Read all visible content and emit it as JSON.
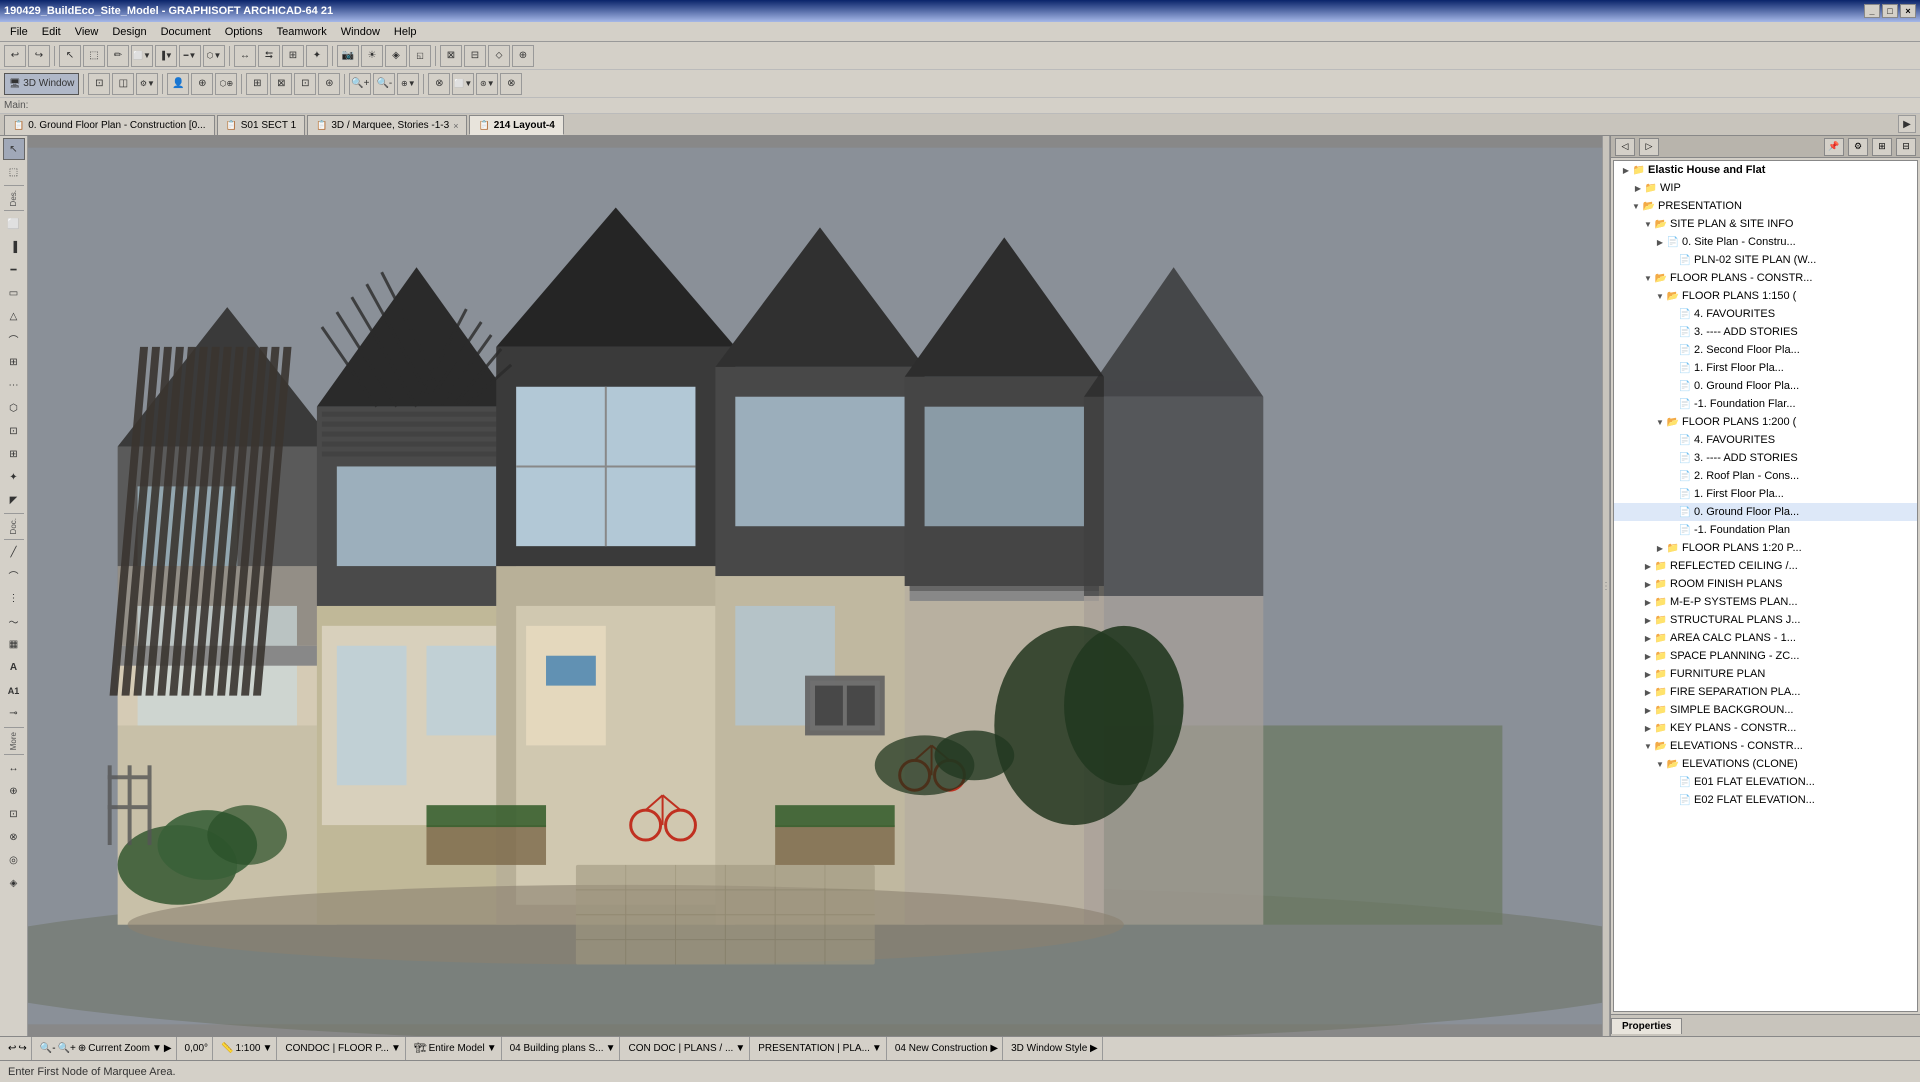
{
  "app": {
    "title": "190429_BuildEco_Site_Model - GRAPHISOFT ARCHICAD-64 21",
    "window_controls": [
      "_",
      "□",
      "×"
    ]
  },
  "menu": {
    "items": [
      "File",
      "Edit",
      "View",
      "Design",
      "Document",
      "Options",
      "Teamwork",
      "Window",
      "Help"
    ]
  },
  "toolbar1": {
    "buttons": [
      "↩",
      "↪",
      "⊕",
      "⊘",
      "🖊",
      "✏",
      "📐",
      "📏",
      "⚙",
      "▼",
      "◈",
      "▼",
      "⬡",
      "▼",
      "⬜",
      "▼",
      "↔",
      "◎",
      "↗",
      "▶",
      "◼",
      "⬟",
      "⊞",
      "✦",
      "📷",
      "🔧",
      "✂",
      "⊡",
      "⊠",
      "⬦",
      "◎",
      "🔲",
      "⊕",
      "▼"
    ]
  },
  "toolbar2": {
    "mode_label": "3D Window",
    "buttons": [
      "⊡",
      "◫",
      "⚙",
      "▼",
      "👤",
      "⊕",
      "⊗",
      "⬡",
      "⊕",
      "⊗",
      "⊞",
      "⊠",
      "⊡",
      "⊛",
      "▶",
      "▼",
      "⊕",
      "◈",
      "⊗",
      "▼",
      "⊗",
      "⊕",
      "⊖",
      "🔲",
      "◫",
      "⊕",
      "⊗",
      "⊡",
      "📷",
      "▼",
      "⊕",
      "⬜",
      "▼",
      "⊛",
      "⊗"
    ]
  },
  "tabs": [
    {
      "id": "tab1",
      "icon": "📋",
      "label": "0. Ground Floor Plan - Construction [0...",
      "active": false,
      "closable": false
    },
    {
      "id": "tab2",
      "icon": "📋",
      "label": "S01 SECT 1",
      "active": false,
      "closable": false
    },
    {
      "id": "tab3",
      "icon": "📋",
      "label": "3D / Marquee, Stories -1-3",
      "active": false,
      "closable": true
    },
    {
      "id": "tab4",
      "icon": "📋",
      "label": "214 Layout-4",
      "active": true,
      "closable": false
    }
  ],
  "left_toolbar": {
    "sections": [
      {
        "label": "Des.",
        "buttons": [
          "↖",
          "⬚",
          "⬜",
          "△",
          "⬡",
          "⬢",
          "◎",
          "⬟",
          "⌒",
          "⋯",
          "✒",
          "⊡",
          "⊠",
          "✦",
          "◤",
          "⊕"
        ]
      },
      {
        "label": "Doc.",
        "buttons": [
          "📝",
          "⊞",
          "⊗",
          "⬡",
          "⊕",
          "A",
          "A1",
          "⋯"
        ]
      },
      {
        "label": "More",
        "buttons": [
          "↔",
          "⊕",
          "⊡",
          "⊗",
          "⬜",
          "◎"
        ]
      }
    ]
  },
  "viewport": {
    "background_color": "#7a8090"
  },
  "right_panel": {
    "header_buttons": [
      "◁",
      "▷",
      "⊡",
      "⊞",
      "⊕",
      "⊗"
    ],
    "tree": {
      "items": [
        {
          "id": "elastic-house",
          "level": 0,
          "toggle": "▶",
          "icon": "📁",
          "label": "Elastic House and Flat",
          "bold": true
        },
        {
          "id": "wip",
          "level": 1,
          "toggle": "▶",
          "icon": "📁",
          "label": "WIP"
        },
        {
          "id": "presentation",
          "level": 1,
          "toggle": "▼",
          "icon": "📂",
          "label": "PRESENTATION"
        },
        {
          "id": "site-plan-info",
          "level": 2,
          "toggle": "▼",
          "icon": "📂",
          "label": "SITE PLAN & SITE INFO"
        },
        {
          "id": "site-plan-constr",
          "level": 3,
          "toggle": "▶",
          "icon": "📄",
          "label": "0. Site Plan - Constru..."
        },
        {
          "id": "pln-02",
          "level": 3,
          "toggle": "",
          "icon": "📄",
          "label": "PLN-02 SITE PLAN (W..."
        },
        {
          "id": "floor-plans-constr",
          "level": 2,
          "toggle": "▼",
          "icon": "📂",
          "label": "FLOOR PLANS - CONSTR..."
        },
        {
          "id": "floor-plans-1150",
          "level": 3,
          "toggle": "▼",
          "icon": "📂",
          "label": "FLOOR PLANS 1:150 ("
        },
        {
          "id": "favourites-1",
          "level": 4,
          "toggle": "",
          "icon": "📄",
          "label": "4. FAVOURITES"
        },
        {
          "id": "add-stories-1",
          "level": 4,
          "toggle": "",
          "icon": "📄",
          "label": "3. ---- ADD STORIES"
        },
        {
          "id": "second-floor-1",
          "level": 4,
          "toggle": "",
          "icon": "📄",
          "label": "2. Second Floor Pla..."
        },
        {
          "id": "first-floor-1",
          "level": 4,
          "toggle": "",
          "icon": "📄",
          "label": "1. First Floor Pla..."
        },
        {
          "id": "ground-floor-1",
          "level": 4,
          "toggle": "",
          "icon": "📄",
          "label": "0. Ground Floor Pla..."
        },
        {
          "id": "foundation-1",
          "level": 4,
          "toggle": "",
          "icon": "📄",
          "label": "-1. Foundation Flar..."
        },
        {
          "id": "floor-plans-1200",
          "level": 3,
          "toggle": "▼",
          "icon": "📂",
          "label": "FLOOR PLANS 1:200 ("
        },
        {
          "id": "favourites-2",
          "level": 4,
          "toggle": "",
          "icon": "📄",
          "label": "4. FAVOURITES"
        },
        {
          "id": "add-stories-2",
          "level": 4,
          "toggle": "",
          "icon": "📄",
          "label": "3. ---- ADD STORIES"
        },
        {
          "id": "roof-plan-cons",
          "level": 4,
          "toggle": "",
          "icon": "📄",
          "label": "2. Roof Plan - Cons..."
        },
        {
          "id": "first-floor-2",
          "level": 4,
          "toggle": "",
          "icon": "📄",
          "label": "1. First Floor Pla..."
        },
        {
          "id": "ground-floor-2",
          "level": 4,
          "toggle": "",
          "icon": "📄",
          "label": "0. Ground Floor Pla..."
        },
        {
          "id": "foundation-2",
          "level": 4,
          "toggle": "",
          "icon": "📄",
          "label": "-1. Foundation Plan"
        },
        {
          "id": "floor-plans-120",
          "level": 3,
          "toggle": "▶",
          "icon": "📁",
          "label": "FLOOR PLANS 1:20 P..."
        },
        {
          "id": "reflected-ceiling",
          "level": 2,
          "toggle": "▶",
          "icon": "📁",
          "label": "REFLECTED CEILING /..."
        },
        {
          "id": "room-finish",
          "level": 2,
          "toggle": "▶",
          "icon": "📁",
          "label": "ROOM FINISH PLANS"
        },
        {
          "id": "mep-systems",
          "level": 2,
          "toggle": "▶",
          "icon": "📁",
          "label": "M-E-P SYSTEMS PLAN..."
        },
        {
          "id": "structural",
          "level": 2,
          "toggle": "▶",
          "icon": "📁",
          "label": "STRUCTURAL PLANS J..."
        },
        {
          "id": "area-calc",
          "level": 2,
          "toggle": "▶",
          "icon": "📁",
          "label": "AREA CALC PLANS - 1..."
        },
        {
          "id": "space-planning",
          "level": 2,
          "toggle": "▶",
          "icon": "📁",
          "label": "SPACE PLANNING - ZC..."
        },
        {
          "id": "furniture-plan",
          "level": 2,
          "toggle": "▶",
          "icon": "📁",
          "label": "FURNITURE PLAN"
        },
        {
          "id": "fire-separation",
          "level": 2,
          "toggle": "▶",
          "icon": "📁",
          "label": "FIRE SEPARATION PLA..."
        },
        {
          "id": "simple-background",
          "level": 2,
          "toggle": "▶",
          "icon": "📁",
          "label": "SIMPLE BACKGROUN..."
        },
        {
          "id": "key-plans",
          "level": 2,
          "toggle": "▶",
          "icon": "📁",
          "label": "KEY PLANS - CONSTR..."
        },
        {
          "id": "elevations-constr",
          "level": 2,
          "toggle": "▼",
          "icon": "📂",
          "label": "ELEVATIONS - CONSTR..."
        },
        {
          "id": "elevations-clone",
          "level": 3,
          "toggle": "▼",
          "icon": "📂",
          "label": "ELEVATIONS (CLONE)"
        },
        {
          "id": "e01-flat",
          "level": 4,
          "toggle": "",
          "icon": "📄",
          "label": "E01 FLAT ELEVATION..."
        },
        {
          "id": "e02-flat",
          "level": 4,
          "toggle": "",
          "icon": "📄",
          "label": "E02 FLAT ELEVATION..."
        }
      ]
    },
    "properties_tab": "Properties"
  },
  "status_bar": {
    "message": "Enter First Node of Marquee Area.",
    "items": [
      {
        "label": "Current Zoom",
        "value": ""
      },
      {
        "label": "",
        "value": "0,00°"
      },
      {
        "label": "",
        "value": "1:100"
      },
      {
        "label": "",
        "value": "CONDOC | FLOOR P..."
      },
      {
        "label": "",
        "value": "Entire Model"
      },
      {
        "label": "",
        "value": "04 Building plans S..."
      },
      {
        "label": "",
        "value": "CON DOC | PLANS / ..."
      },
      {
        "label": "",
        "value": "PRESENTATION | PLA..."
      },
      {
        "label": "",
        "value": "04 New Construction ▶"
      },
      {
        "label": "",
        "value": "3D Window Style ▶"
      }
    ]
  },
  "main_label": "Main:",
  "view_type": "3D / Marquee, Stories -1-3"
}
